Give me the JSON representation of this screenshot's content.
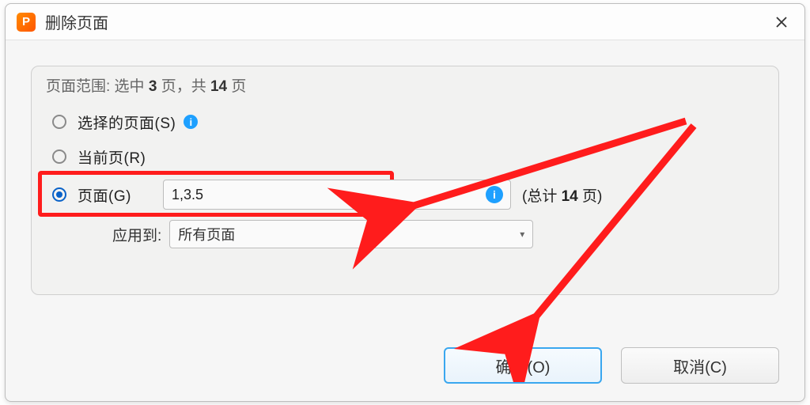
{
  "window": {
    "title": "删除页面"
  },
  "group": {
    "legend_prefix": "页面范围: 选中 ",
    "selected_count": "3",
    "legend_mid": " 页，共 ",
    "total_count": "14",
    "legend_suffix": " 页"
  },
  "options": {
    "selected_pages": {
      "label": "选择的页面(S)"
    },
    "current_page": {
      "label": "当前页(R)"
    },
    "page_range": {
      "label": "页面(G)",
      "value": "1,3.5"
    }
  },
  "total_suffix": {
    "open": "(总计 ",
    "count": "14",
    "close": " 页)"
  },
  "apply_to": {
    "label": "应用到:",
    "value": "所有页面"
  },
  "buttons": {
    "ok": "确定(O)",
    "cancel": "取消(C)"
  },
  "icons": {
    "logo_letter": "P",
    "info": "i"
  }
}
